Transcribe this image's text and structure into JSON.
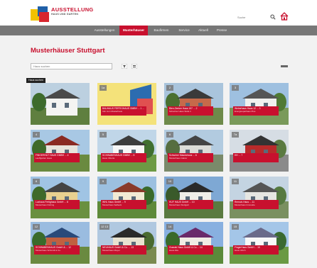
{
  "header": {
    "brand_name": "AUSSTELLUNG",
    "brand_sub": "HAUS UND GARTEN",
    "search_placeholder": "Suche"
  },
  "nav": {
    "items": [
      {
        "label": "Ausstellungen",
        "active": false
      },
      {
        "label": "Musterhäuser",
        "active": true
      },
      {
        "label": "Baufirmen",
        "active": false
      },
      {
        "label": "Service",
        "active": false
      },
      {
        "label": "Aktuell",
        "active": false
      },
      {
        "label": "Presse",
        "active": false
      }
    ]
  },
  "main": {
    "title": "Musterhäuser Stuttgart",
    "filter_placeholder": "Haus suchen",
    "tooltip": "Haus suchen"
  },
  "cards": [
    {
      "num": "",
      "title": "",
      "sub": "",
      "theme": "white"
    },
    {
      "num": "1a",
      "title": "BAUHAUS FERTIGHAUS GMBH ... 1 ...",
      "sub": "Info zum Musterhaus",
      "theme": "promo"
    },
    {
      "num": "2",
      "title": "Bien-Zenker Haus 157 ... 2",
      "sub": "Schwörer Haus Stufe 1",
      "theme": "brick"
    },
    {
      "num": "3",
      "title": "Weberhaus Haus 12 ... 3",
      "sub": "Energiesparhaus Plus",
      "theme": "white2"
    },
    {
      "num": "4",
      "title": "FINGERHUT HAUS GMBH ... 4",
      "sub": "Lauffgarten Haus",
      "theme": "brick2"
    },
    {
      "num": "5",
      "title": "SCHWABENHAUS GMBH ... 5",
      "sub": "Haus Vittoria",
      "theme": "white3"
    },
    {
      "num": "6",
      "title": "Schwörer Massivhaus ... 6",
      "sub": "Musterhaus Glazer",
      "theme": "gray"
    },
    {
      "num": "7a",
      "title": "HH ... 7",
      "sub": "",
      "theme": "red"
    },
    {
      "num": "8",
      "title": "Luxhaus Fertighaus GmbH ... 8",
      "sub": "Musterhaus Fishing",
      "theme": "yellow"
    },
    {
      "num": "9",
      "title": "WHL Haus GmbH ... 9",
      "sub": "Musterhaus Salbeck",
      "theme": "cream"
    },
    {
      "num": "10",
      "title": "HUF HAUS GmbH ... 10",
      "sub": "Musterhaus Stuttgart",
      "theme": "dark"
    },
    {
      "num": "11",
      "title": "Rensch-Haus ... 11",
      "sub": "Musterhaus Innosuite",
      "theme": "gray2"
    },
    {
      "num": "12",
      "title": "SCHWABENHAUS GmbH & ... 12",
      "sub": "Musterhaus Schmidt & Co.",
      "theme": "brick3"
    },
    {
      "num": "12 13",
      "title": "NEUHAUS GmbH & Co. ... 13",
      "sub": "Musterhaus Meyer",
      "theme": "timber"
    },
    {
      "num": "14",
      "title": "Gussek Haus GmbH & Co ... 14",
      "sub": "Haus Alta",
      "theme": "purple"
    },
    {
      "num": "15",
      "title": "FingerHaus GmbH ... 15",
      "sub": "Haus Ulrich",
      "theme": "white4"
    }
  ]
}
